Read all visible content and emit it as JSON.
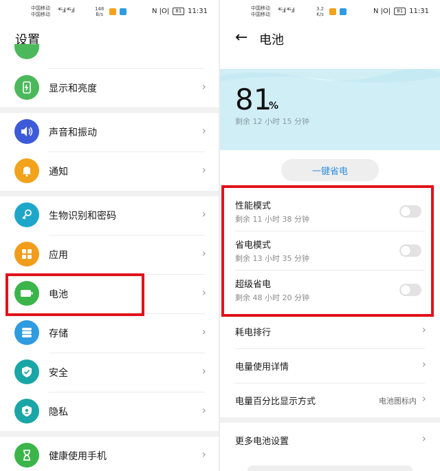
{
  "left": {
    "status": {
      "carrier1": "中国移动",
      "carrier2": "中国移动",
      "signal": "⁴ᴳ.ıl ⁴ᴳ.ıl",
      "speed_value": "148",
      "speed_unit": "B/s",
      "hd": "HD",
      "right_icons": "N |O|",
      "battery": "81",
      "time": "11:31"
    },
    "title": "设置",
    "items": [
      {
        "label": "显示和亮度",
        "icon": "display-icon",
        "color": "#4cb85c"
      },
      {
        "label": "声音和振动",
        "icon": "speaker-icon",
        "color": "#3d5bd9"
      },
      {
        "label": "通知",
        "icon": "bell-icon",
        "color": "#f2a21b"
      },
      {
        "label": "生物识别和密码",
        "icon": "key-icon",
        "color": "#1ea7c9"
      },
      {
        "label": "应用",
        "icon": "apps-icon",
        "color": "#f29c1b"
      },
      {
        "label": "电池",
        "icon": "battery-icon",
        "color": "#3bb54a"
      },
      {
        "label": "存储",
        "icon": "storage-icon",
        "color": "#2f9ce0"
      },
      {
        "label": "安全",
        "icon": "shield-icon",
        "color": "#1aa6a6"
      },
      {
        "label": "隐私",
        "icon": "privacy-icon",
        "color": "#1aa6a6"
      },
      {
        "label": "健康使用手机",
        "icon": "hourglass-icon",
        "color": "#3bb54a"
      }
    ]
  },
  "right": {
    "status": {
      "carrier1": "中国移动",
      "carrier2": "中国移动",
      "signal": "⁴ᴳ.ıl ⁴ᴳ.ıl",
      "speed_value": "3.2",
      "speed_unit": "K/s",
      "hd": "HD",
      "right_icons": "N |O|",
      "battery": "81",
      "time": "11:31"
    },
    "title": "电池",
    "battery_percent": "81",
    "percent_unit": "%",
    "remaining": "剩余 12 小时 15 分钟",
    "one_key_label": "一键省电",
    "modes": [
      {
        "name": "性能模式",
        "remaining": "剩余 11 小时 38 分钟",
        "enabled": false
      },
      {
        "name": "省电模式",
        "remaining": "剩余 13 小时 35 分钟",
        "enabled": false
      },
      {
        "name": "超级省电",
        "remaining": "剩余 48 小时 20 分钟",
        "enabled": false
      }
    ],
    "rows": [
      {
        "label": "耗电排行",
        "value": ""
      },
      {
        "label": "电量使用详情",
        "value": ""
      },
      {
        "label": "电量百分比显示方式",
        "value": "电池图标内"
      },
      {
        "label": "更多电池设置",
        "value": ""
      }
    ]
  },
  "colors": {
    "highlight_red": "#e0121b",
    "accent_blue": "#2f8fe0",
    "hero_bg": "#d0eef6"
  }
}
